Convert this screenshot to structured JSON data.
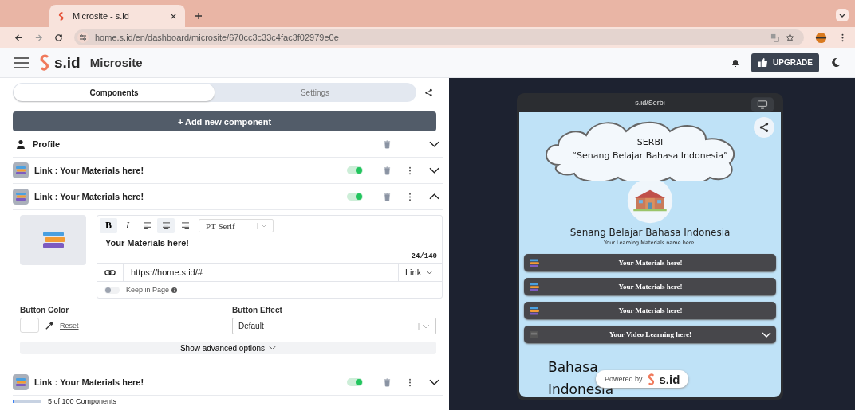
{
  "browser": {
    "tab_title": "Microsite - s.id",
    "url": "home.s.id/en/dashboard/microsite/670cc3c33c4fac3f02979e0e"
  },
  "header": {
    "brand": "s.id",
    "section": "Microsite",
    "upgrade": "UPGRADE"
  },
  "tabs": [
    {
      "label": "Components",
      "selected": true
    },
    {
      "label": "Settings",
      "selected": false
    }
  ],
  "add_button": "+ Add new component",
  "components": [
    {
      "kind": "profile",
      "title": "Profile",
      "expanded": false
    },
    {
      "kind": "link",
      "title": "Link : Your Materials here!",
      "enabled": true,
      "expanded": false
    },
    {
      "kind": "link",
      "title": "Link : Your Materials here!",
      "enabled": true,
      "expanded": true
    },
    {
      "kind": "link",
      "title": "Link : Your Materials here!",
      "enabled": true,
      "expanded": false
    }
  ],
  "editor": {
    "toolbar": [
      {
        "kind": "bold",
        "label": "B",
        "active": true
      },
      {
        "kind": "italic",
        "label": "I",
        "active": false
      },
      {
        "kind": "align-left",
        "active": false
      },
      {
        "kind": "align-center",
        "active": true
      },
      {
        "kind": "align-right",
        "active": false
      }
    ],
    "font": "PT Serif",
    "text": "Your Materials here!",
    "counter": "24/140",
    "url": "https://home.s.id/#",
    "link_type": "Link",
    "keep_in_page": {
      "label": "Keep in Page",
      "on": false
    },
    "button_color_label": "Button Color",
    "reset": "Reset",
    "button_effect_label": "Button Effect",
    "button_effect": "Default",
    "advanced": "Show advanced options"
  },
  "footer": "5 of 100 Components",
  "preview": {
    "url": "s.id/Serbi",
    "title": "SERBI",
    "tagline": "“Senang Belajar Bahasa Indonesia”",
    "name": "Senang Belajar Bahasa Indonesia",
    "bio": "Your Learning Materials name here!",
    "links": [
      {
        "kind": "link",
        "title": "Your Materials here!"
      },
      {
        "kind": "link",
        "title": "Your Materials here!"
      },
      {
        "kind": "link",
        "title": "Your Materials here!"
      },
      {
        "kind": "video",
        "title": "Your Video Learning here!"
      }
    ],
    "background_words": [
      "Bahasa",
      "Indonesia"
    ],
    "powered_by": "Powered by",
    "powered_brand": "s.id"
  }
}
